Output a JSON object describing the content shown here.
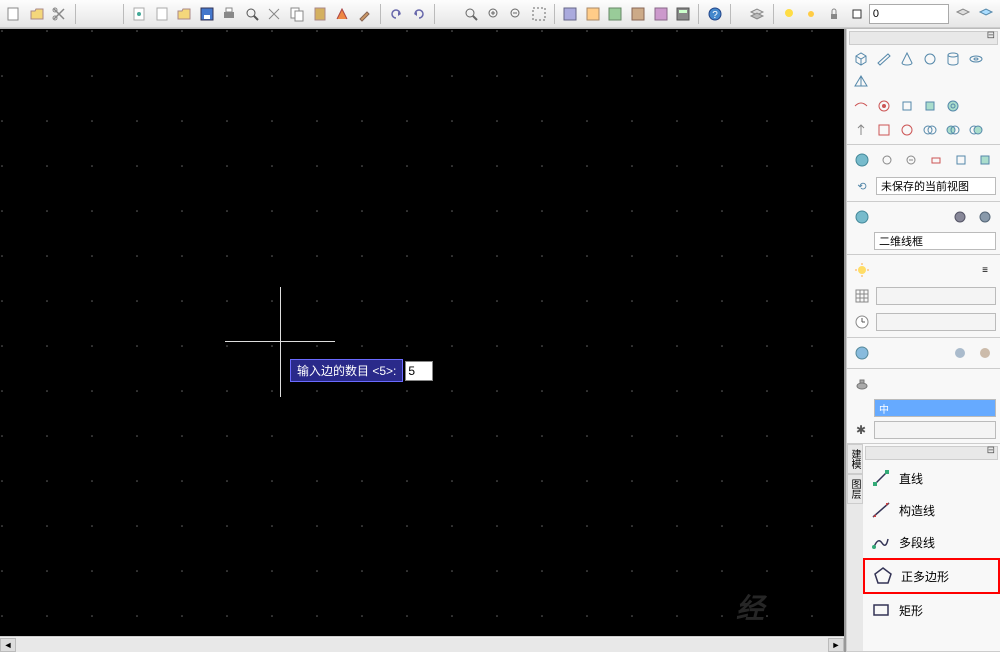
{
  "toolbar_dropdown": "0",
  "prompt": {
    "label": "输入边的数目 <5>:",
    "value": "5"
  },
  "panels": {
    "view_label": "未保存的当前视图",
    "style_label": "二维线框",
    "china_mark": "中"
  },
  "tools": {
    "tab1": "建模",
    "tab2": "图层",
    "line": "直线",
    "construction": "构造线",
    "polyline": "多段线",
    "polygon": "正多边形",
    "rectangle": "矩形"
  },
  "watermark": "经"
}
